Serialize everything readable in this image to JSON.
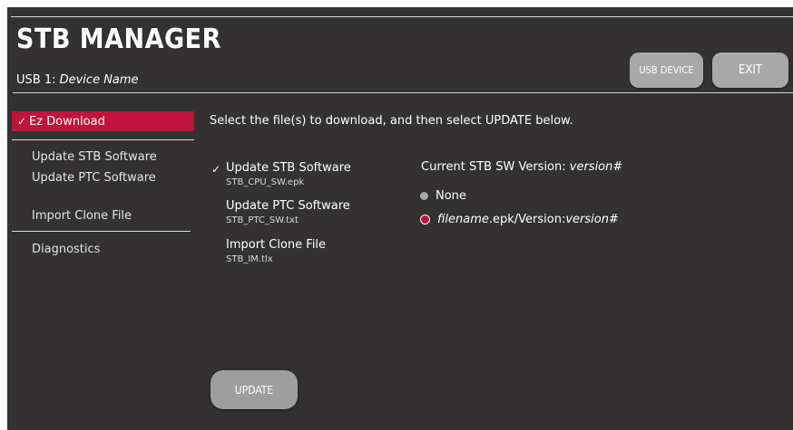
{
  "header": {
    "title": "STB MANAGER",
    "usb_prefix": "USB 1: ",
    "usb_device_name": "Device Name",
    "usb_device_button": "USB DEVICE",
    "exit_button": "EXIT"
  },
  "sidebar": {
    "items": [
      {
        "label": "Ez Download",
        "active": true,
        "check": "✓"
      },
      {
        "label": "Update STB Software"
      },
      {
        "label": "Update PTC Software"
      },
      {
        "label": "Import Clone File"
      },
      {
        "label": "Diagnostics"
      }
    ]
  },
  "main": {
    "instruction": "Select the file(s) to download, and then select UPDATE below.",
    "options": [
      {
        "title": "Update STB Software",
        "file": "STB_CPU_SW.epk",
        "checked": true,
        "check": "✓"
      },
      {
        "title": "Update PTC Software",
        "file": "STB_PTC_SW.txt"
      },
      {
        "title": "Import Clone File",
        "file": "STB_IM.tlx"
      }
    ],
    "version": {
      "label": "Current STB SW Version: ",
      "value": "version#"
    },
    "radios": [
      {
        "text": "None",
        "selected": false
      },
      {
        "filename": "filename",
        "ext": ".epk/Version: ",
        "version": "version#",
        "selected": true
      }
    ],
    "update_button": "UPDATE"
  },
  "colors": {
    "background": "#333132",
    "accent": "#c0133b",
    "button": "#a9a8a9"
  }
}
